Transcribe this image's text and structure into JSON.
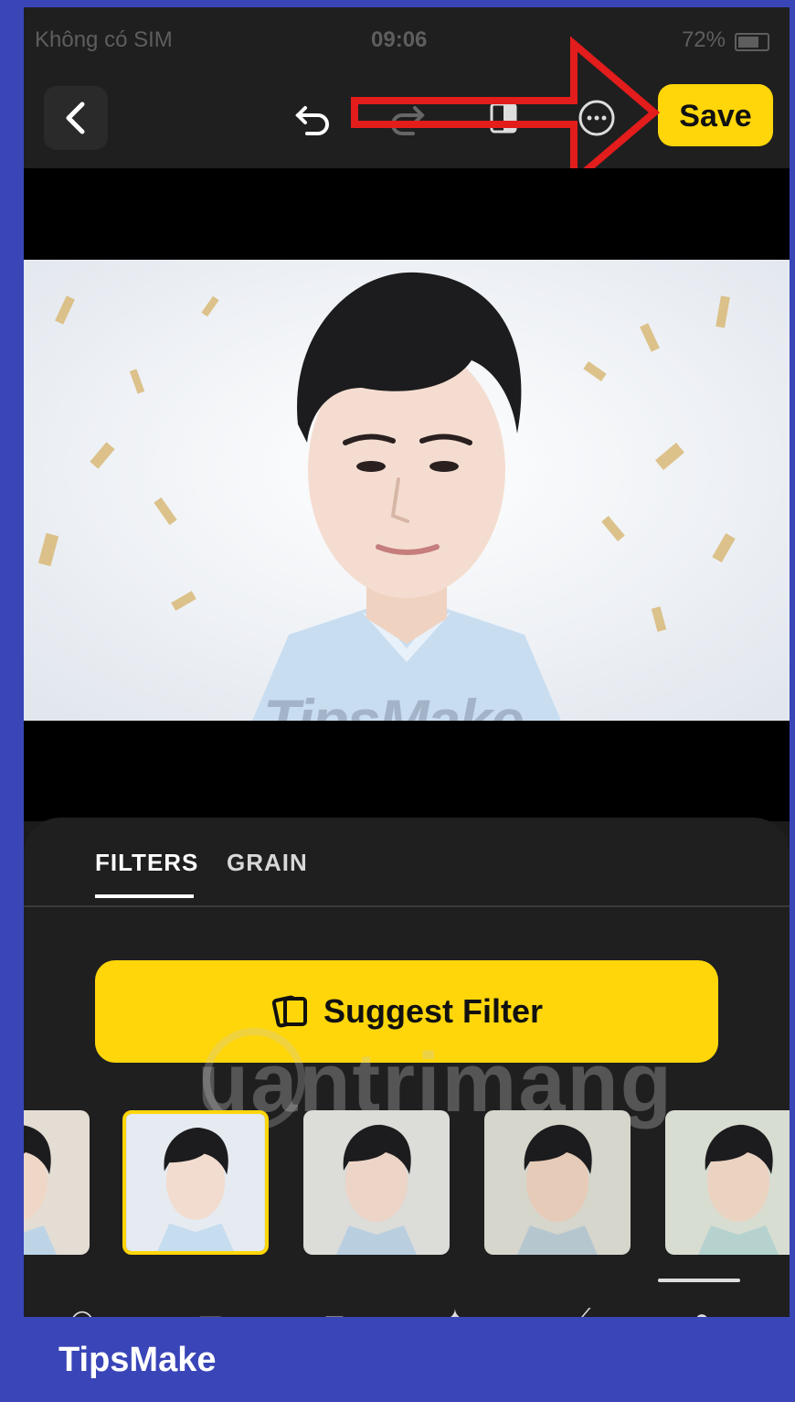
{
  "status_bar": {
    "carrier": "Không có SIM",
    "time": "09:06",
    "battery": "72%"
  },
  "toolbar": {
    "back_icon": "chevron-left-icon",
    "undo_icon": "undo-icon",
    "redo_icon": "redo-icon",
    "compare_icon": "compare-icon",
    "more_icon": "more-icon",
    "save_label": "Save"
  },
  "colors": {
    "accent": "#ffd60a",
    "annotation": "#e31c1c",
    "banner": "#3a45b8"
  },
  "tabs": [
    {
      "label": "FILTERS",
      "active": true
    },
    {
      "label": "GRAIN",
      "active": false
    }
  ],
  "suggest": {
    "label": "Suggest Filter",
    "icon": "cards-icon"
  },
  "filters": {
    "selected_index": 1
  },
  "watermarks": {
    "photo": "TipsMake",
    "overlay": "uantrimang"
  },
  "banner": {
    "text": "TipsMake"
  }
}
